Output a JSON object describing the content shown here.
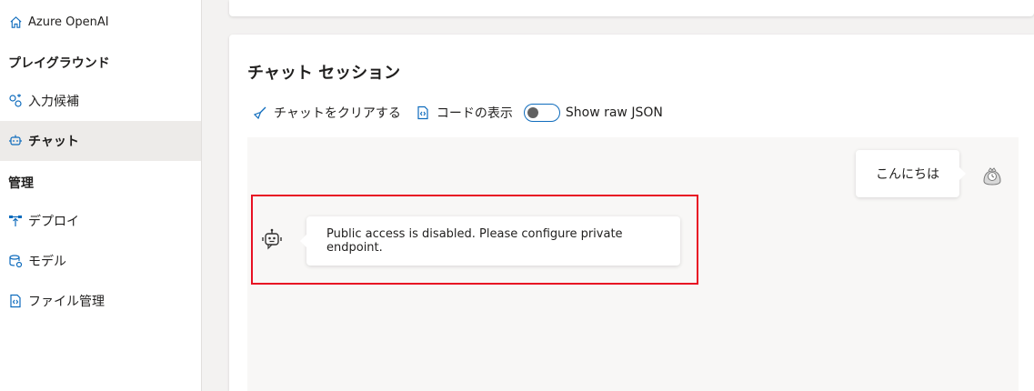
{
  "sidebar": {
    "home_label": "Azure OpenAI",
    "section_playground": "プレイグラウンド",
    "items_playground": [
      {
        "label": "入力候補",
        "icon": "completions-icon"
      },
      {
        "label": "チャット",
        "icon": "chat-bot-icon",
        "active": true
      }
    ],
    "section_management": "管理",
    "items_management": [
      {
        "label": "デプロイ",
        "icon": "deploy-icon"
      },
      {
        "label": "モデル",
        "icon": "models-icon"
      },
      {
        "label": "ファイル管理",
        "icon": "file-management-icon"
      }
    ]
  },
  "chat": {
    "title": "チャット セッション",
    "toolbar": {
      "clear_label": "チャットをクリアする",
      "code_label": "コードの表示",
      "raw_json_label": "Show raw JSON",
      "raw_json_on": false
    },
    "messages": [
      {
        "role": "user",
        "text": "こんにちは"
      },
      {
        "role": "assistant",
        "text": "Public access is disabled. Please configure private endpoint."
      }
    ]
  },
  "colors": {
    "accent": "#0f6cbd",
    "highlight": "#e81123",
    "active_item_bg": "#edebe9",
    "chat_area_bg": "#f8f7f6"
  }
}
